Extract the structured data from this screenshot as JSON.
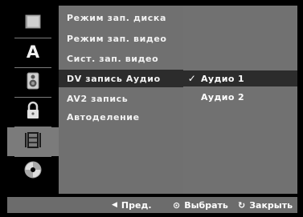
{
  "sidebar": {
    "icons": [
      {
        "name": "disc-icon"
      },
      {
        "name": "language-a-icon"
      },
      {
        "name": "speaker-icon"
      },
      {
        "name": "lock-icon"
      },
      {
        "name": "film-icon"
      },
      {
        "name": "dvd-disc-icon"
      }
    ],
    "active_index": 4
  },
  "menu": {
    "items": [
      {
        "label": "Режим зап. диска"
      },
      {
        "label": "Режим зап. видео"
      },
      {
        "label": "Сист. зап. видео"
      },
      {
        "label": "DV запись Аудио"
      },
      {
        "label": "AV2 запись"
      },
      {
        "label": "Автоделение"
      }
    ],
    "selected_index": 3
  },
  "options": {
    "items": [
      {
        "label": "Аудио 1",
        "checked": true
      },
      {
        "label": "Аудио 2",
        "checked": false
      }
    ],
    "check_symbol": "✓"
  },
  "footer": {
    "prev": {
      "symbol": "◀",
      "label": "Пред."
    },
    "select": {
      "symbol": "⊙",
      "label": "Выбрать"
    },
    "close": {
      "symbol": "↻",
      "label": "Закрыть"
    }
  },
  "colors": {
    "panel_gray": "#707070",
    "highlight": "#2c2c2c",
    "background": "#000000"
  }
}
